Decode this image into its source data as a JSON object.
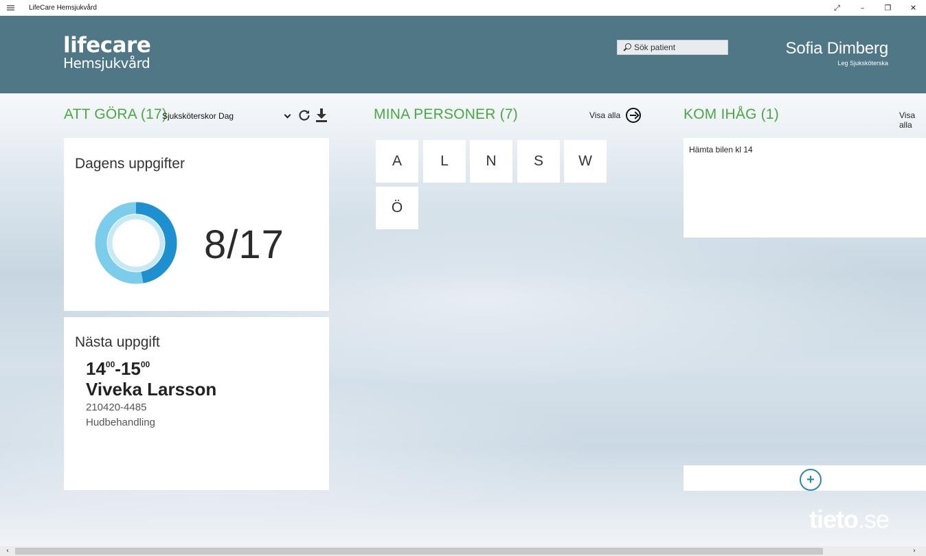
{
  "window": {
    "title": "LifeCare Hemsjukvård",
    "controls": {
      "fullscreen": "⤢",
      "minimize": "–",
      "restore": "❐",
      "close": "✕"
    }
  },
  "header": {
    "logo_main": "lifecare",
    "logo_sub": "Hemsjukvård",
    "search_placeholder": "Sök patient",
    "user_name": "Sofia Dimberg",
    "user_role": "Leg Sjuksköterska"
  },
  "todo": {
    "title": "ATT GÖRA (17)",
    "filter_value": "Sjuksköterskor Dag",
    "progress_card": {
      "title": "Dagens uppgifter",
      "count_text": "8/17",
      "completed": 8,
      "total": 17
    },
    "next_card": {
      "title": "Nästa uppgift",
      "time_start": "14",
      "time_start_min": "00",
      "time_sep": "-",
      "time_end": "15",
      "time_end_min": "00",
      "patient_name": "Viveka Larsson",
      "personal_number": "210420-4485",
      "task": "Hudbehandling"
    }
  },
  "persons": {
    "title": "MINA PERSONER (7)",
    "show_all": "Visa alla",
    "letters": [
      "A",
      "L",
      "N",
      "S",
      "W",
      "Ö"
    ]
  },
  "remember": {
    "title": "KOM IHÅG (1)",
    "show_all": "Visa alla",
    "note": "Hämta bilen kl 14",
    "add_symbol": "+"
  },
  "footer": {
    "brand_main": "tieto",
    "brand_suffix": ".se"
  },
  "colors": {
    "header_bg": "#4f7786",
    "section_title": "#4aa842",
    "donut_dark": "#1e8fcf",
    "donut_light": "#7cccec",
    "accent": "#2b86b8"
  }
}
